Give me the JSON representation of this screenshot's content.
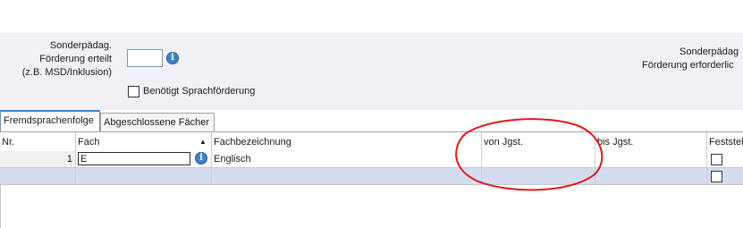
{
  "form": {
    "left_label_lines": [
      "Sonderpädag.",
      "Förderung erteilt",
      "(z.B. MSD/Inklusion)"
    ],
    "right_label_lines": [
      "Sonderpädag",
      "Förderung erforderlic"
    ],
    "sprach_checkbox_label": "Benötigt Sprachförderung",
    "sprach_checked": false,
    "info_icon": "info-icon"
  },
  "tabs": [
    {
      "label": "Fremdsprachenfolge",
      "active": true
    },
    {
      "label": "Abgeschlossene Fächer",
      "active": false
    }
  ],
  "grid": {
    "columns": [
      "Nr.",
      "Fach",
      "Fachbezeichnung",
      "von Jgst.",
      "bis Jgst.",
      "Feststel"
    ],
    "sort_icon": "sort-ascending-icon",
    "rows": [
      {
        "nr": "1",
        "fach": "E",
        "fachbezeichnung": "Englisch",
        "von": "",
        "bis": "",
        "feststell": false
      },
      {
        "nr": "",
        "fach": "",
        "fachbezeichnung": "",
        "von": "",
        "bis": "",
        "feststell": false
      }
    ]
  },
  "annotation": {
    "color": "#e01818",
    "shape": "hand-drawn circle around von Jgst. column"
  }
}
